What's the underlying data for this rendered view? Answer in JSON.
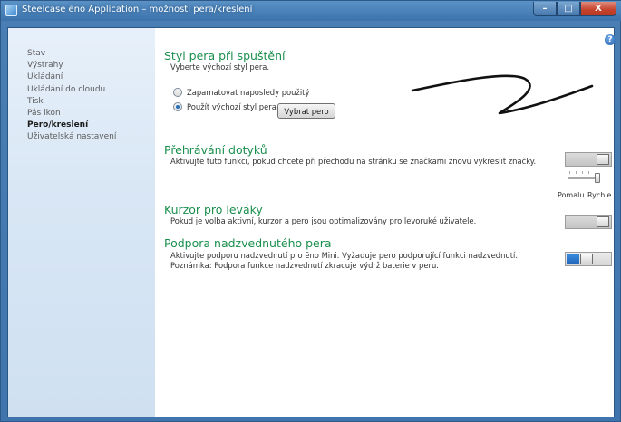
{
  "window": {
    "title": "Steelcase ēno Application – možnosti pera/kreslení",
    "minimize_glyph": "–",
    "maximize_glyph": "□",
    "close_glyph": "X"
  },
  "sidebar": {
    "items": [
      {
        "label": "Stav",
        "active": false
      },
      {
        "label": "Výstrahy",
        "active": false
      },
      {
        "label": "Ukládání",
        "active": false
      },
      {
        "label": "Ukládání do cloudu",
        "active": false
      },
      {
        "label": "Tisk",
        "active": false
      },
      {
        "label": "Pás ikon",
        "active": false
      },
      {
        "label": "Pero/kreslení",
        "active": true
      },
      {
        "label": "Uživatelská nastavení",
        "active": false
      }
    ]
  },
  "help": {
    "glyph": "?"
  },
  "pen_style": {
    "title": "Styl pera při spuštění",
    "description": "Vyberte výchozí styl pera.",
    "option_remember": "Zapamatovat naposledy použitý",
    "option_default": "Použít výchozí styl pera",
    "selected": "option_default",
    "select_button": "Vybrat pero",
    "preview_color": "#111111"
  },
  "touch_replay": {
    "title": "Přehrávání dotyků",
    "description": "Aktivujte tuto funkci, pokud chcete při přechodu na stránku se značkami znovu vykreslit značky.",
    "toggle_on": false,
    "speed_slow": "Pomalu",
    "speed_fast": "Rychle",
    "speed_value": 1.0
  },
  "left_handed": {
    "title": "Kurzor pro leváky",
    "description": "Pokud je volba aktivní, kurzor a pero jsou optimalizovány pro levoruké uživatele.",
    "toggle_on": false
  },
  "hover": {
    "title": "Podpora nadzvednutého pera",
    "description_1": "Aktivujte podporu nadzvednutí pro ēno Mini. Vyžaduje pero podporující funkci nadzvednutí.",
    "description_2": "Poznámka: Podpora funkce nadzvednutí zkracuje výdrž baterie v peru.",
    "toggle_on": true
  },
  "colors": {
    "section_title": "#1a8f4d",
    "accent_blue": "#1f63b5",
    "sidebar_bg": "#dbe8f5"
  }
}
